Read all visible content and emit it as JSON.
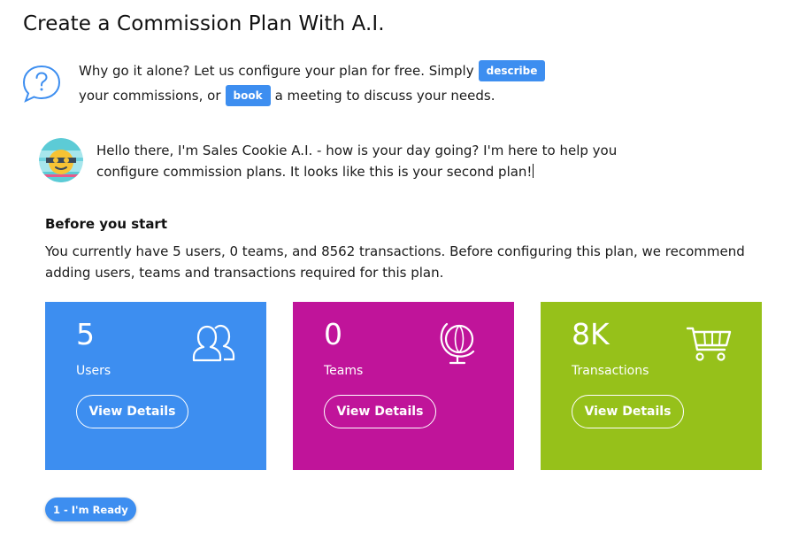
{
  "page": {
    "title": "Create a Commission Plan With A.I."
  },
  "intro": {
    "text_before": "Why go it alone? Let us configure your plan for free. Simply",
    "describe_label": "describe",
    "text_middle": "your commissions, or",
    "book_label": "book",
    "text_after": "a meeting to discuss your needs."
  },
  "bot": {
    "message": "Hello there, I'm Sales Cookie A.I. - how is your day going? I'm here to help you configure commission plans. It looks like this is your second plan!"
  },
  "before": {
    "title": "Before you start",
    "text": "You currently have 5 users, 0 teams, and 8562 transactions. Before configuring this plan, we recommend adding users, teams and transactions required for this plan."
  },
  "cards": [
    {
      "value": "5",
      "label": "Users",
      "button": "View Details",
      "icon": "users-icon",
      "color": "#3d8ef0"
    },
    {
      "value": "0",
      "label": "Teams",
      "button": "View Details",
      "icon": "globe-icon",
      "color": "#c0149a"
    },
    {
      "value": "8K",
      "label": "Transactions",
      "button": "View Details",
      "icon": "cart-icon",
      "color": "#96c11a"
    }
  ],
  "ready_button": {
    "label": "1 - I'm Ready",
    "color": "#3d8ef0"
  },
  "colors": {
    "accent": "#3d8ef0"
  }
}
